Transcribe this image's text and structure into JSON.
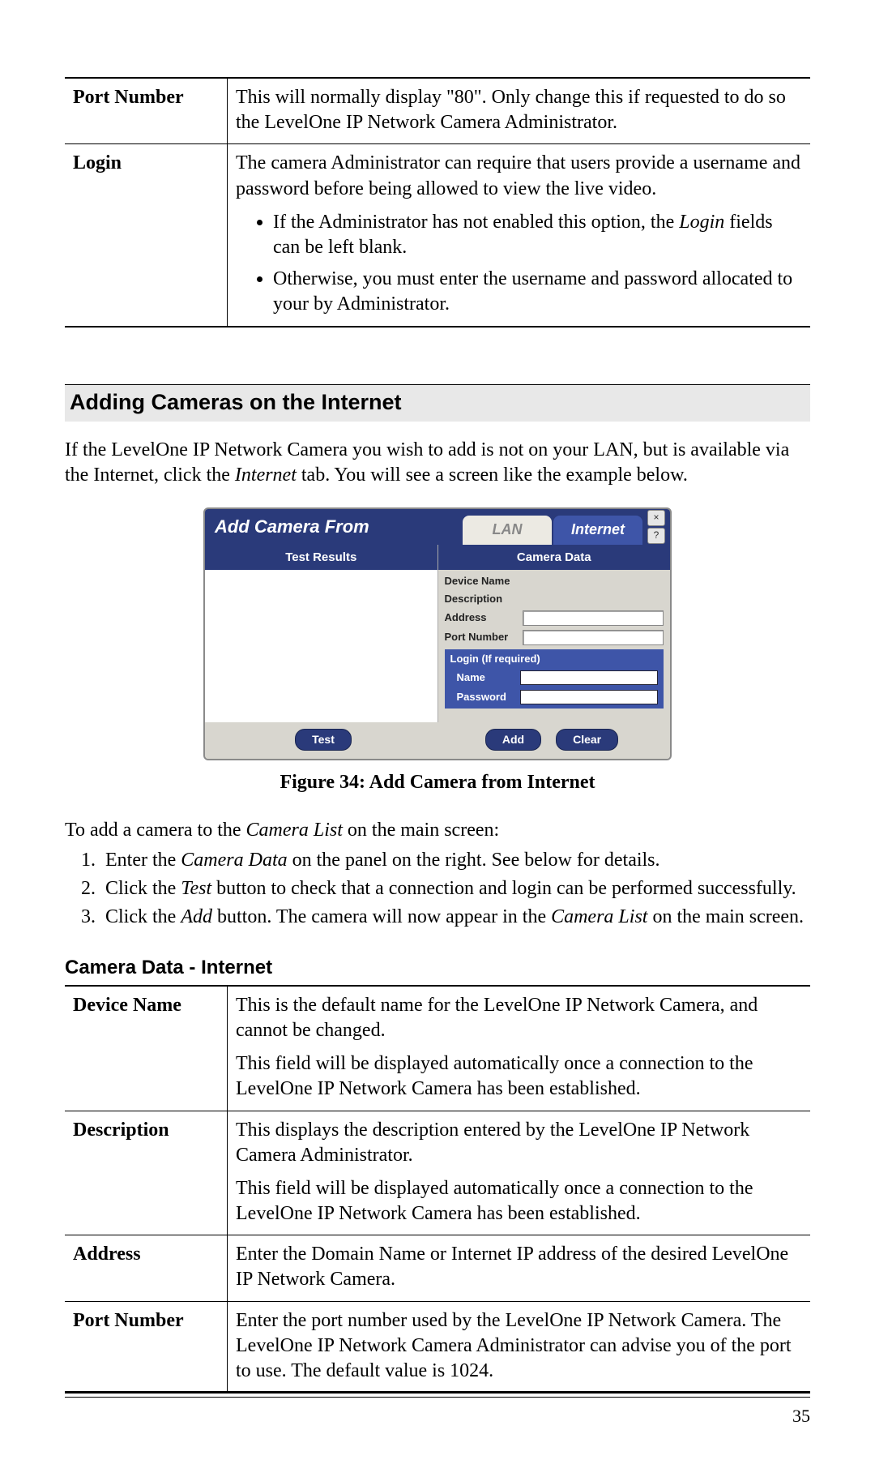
{
  "table1": {
    "rows": [
      {
        "label": "Port Number",
        "desc": "This will normally display \"80\". Only change this if requested to do so the LevelOne IP Network Camera Administrator."
      },
      {
        "label": "Login",
        "desc": "The camera Administrator can require that users provide a username and password before being allowed to view the live video.",
        "bullets": [
          "If the Administrator has not enabled this option, the Login fields can be left blank.",
          "Otherwise, you must enter the username and password allocated to your by Administrator."
        ]
      }
    ]
  },
  "section_heading": "Adding Cameras on the Internet",
  "intro_a": "If the LevelOne IP Network Camera you wish to add is not on your LAN, but is available via the Internet, click the ",
  "intro_b": " tab. You will see a screen like the example below.",
  "dialog": {
    "title": "Add Camera From",
    "tab_lan": "LAN",
    "tab_internet": "Internet",
    "left_header": "Test Results",
    "right_header": "Camera Data",
    "field_device": "Device Name",
    "field_description": "Description",
    "field_address": "Address",
    "field_port": "Port Number",
    "login_title": "Login (If required)",
    "login_name": "Name",
    "login_password": "Password",
    "btn_test": "Test",
    "btn_add": "Add",
    "btn_clear": "Clear",
    "close": "×",
    "help": "?"
  },
  "figcap": "Figure 34: Add Camera from Internet",
  "to_add_a": "To add a camera to the ",
  "to_add_b": " on the main screen:",
  "steps": [
    {
      "a": "Enter the ",
      "i": "Camera Data",
      "b": " on the panel on the right. See below for details."
    },
    {
      "a": "Click the ",
      "i": "Test",
      "b": " button to check that a connection and login can be performed successfully."
    },
    {
      "a": "Click the ",
      "i": "Add",
      "b": " button. The camera will now appear in the ",
      "i2": "Camera List",
      "c": " on the main screen."
    }
  ],
  "sub_heading": "Camera Data - Internet",
  "table2": {
    "rows": [
      {
        "label": "Device Name",
        "p1": "This is the default name for the LevelOne IP Network Camera, and cannot be changed.",
        "p2": "This field will be displayed automatically once a connection to the LevelOne IP Network Camera has been established."
      },
      {
        "label": "Description",
        "p1": "This displays the description entered by the LevelOne IP Network Camera Administrator.",
        "p2": "This field will be displayed automatically once a connection to the LevelOne IP Network Camera has been established."
      },
      {
        "label": "Address",
        "p1": "Enter the Domain Name or Internet IP address of the desired LevelOne IP Network Camera."
      },
      {
        "label": "Port Number",
        "p1": "Enter the port number used by the LevelOne IP Network Camera. The LevelOne IP Network Camera Administrator can advise you of the port to use. The default value is 1024."
      }
    ]
  },
  "italic_internet": "Internet",
  "italic_cameralist": "Camera List",
  "italic_login": "Login",
  "page_num": "35"
}
